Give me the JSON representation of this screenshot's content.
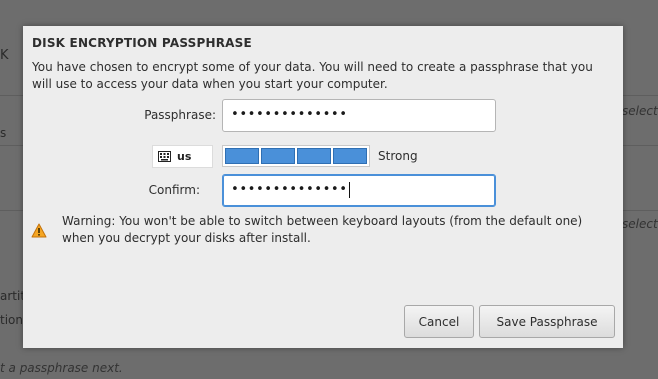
{
  "dialog": {
    "title": "DISK ENCRYPTION PASSPHRASE",
    "description": "You have chosen to encrypt some of your data. You will need to create a passphrase that you will use to access your data when you start your computer.",
    "passphrase_label": "Passphrase:",
    "passphrase_value": "••••••••••••••",
    "keyboard_layout": "us",
    "strength": {
      "label": "Strong",
      "filled_segments": 4,
      "total_segments": 4,
      "color": "#4a90d9"
    },
    "confirm_label": "Confirm:",
    "confirm_value": "••••••••••••••",
    "warning": "Warning: You won't be able to switch between keyboard layouts (from the default one) when you decrypt your disks after install.",
    "cancel_label": "Cancel",
    "save_label": "Save Passphrase"
  },
  "background": {
    "left_text_1": "K",
    "left_text_2": "s",
    "right_text_1": "selecte",
    "right_text_2": "selecte",
    "left_text_3": "artiti",
    "left_text_4": "tiona",
    "bottom_text": "t a passphrase next."
  },
  "icons": {
    "keyboard": "keyboard-icon",
    "warning": "warning-icon"
  }
}
